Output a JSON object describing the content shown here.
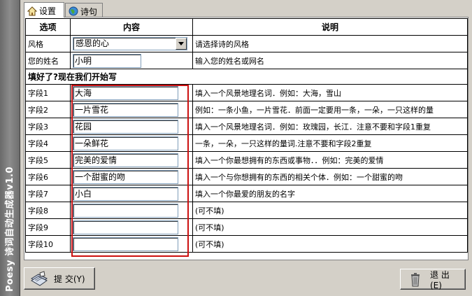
{
  "app": {
    "banner_title": "Poesy 诗词自动生成器v1.0"
  },
  "tabs": [
    {
      "label": "设置",
      "icon": "home-icon",
      "active": true
    },
    {
      "label": "诗句",
      "icon": "globe-icon",
      "active": false
    }
  ],
  "table": {
    "headers": [
      "选项",
      "内容",
      "说明"
    ],
    "style_row": {
      "label": "风格",
      "value": "感恩的心",
      "note": "请选择诗的风格"
    },
    "name_row": {
      "label": "您的姓名",
      "value": "小明",
      "note": "输入您的姓名或网名"
    },
    "section_title": "填好了?现在我们开始写",
    "fields": [
      {
        "label": "字段1",
        "value": "大海",
        "note": "填入一个风景地理名词．例如：大海，雪山"
      },
      {
        "label": "字段2",
        "value": "一片雪花",
        "note": "例如：一条小鱼，一片雪花．前面一定要用一条，一朵，一只这样的量"
      },
      {
        "label": "字段3",
        "value": "花园",
        "note": "填入一个风景地理名词．例如：玫瑰园，长江．注意不要和字段1重复"
      },
      {
        "label": "字段4",
        "value": "一朵鲜花",
        "note": "一条，一朵，一只这样的量词.注意不要和字段2重复"
      },
      {
        "label": "字段5",
        "value": "完美的爱情",
        "note": "填入一个你最想拥有的东西或事物．．例如：完美的爱情"
      },
      {
        "label": "字段6",
        "value": "一个甜蜜的吻",
        "note": "填入一个与你想拥有的东西的相关个体．例如：一个甜蜜的吻"
      },
      {
        "label": "字段7",
        "value": "小白",
        "note": "填入一个你最爱的朋友的名字"
      },
      {
        "label": "字段8",
        "value": "",
        "note": "(可不填)"
      },
      {
        "label": "字段9",
        "value": "",
        "note": "(可不填)"
      },
      {
        "label": "字段10",
        "value": "",
        "note": "(可不填)"
      }
    ]
  },
  "buttons": {
    "submit_label": "提 交(Y)",
    "exit_label": "退 出(E)"
  },
  "colors": {
    "highlight_box": "#cc1010",
    "window_bg": "#d4d0c8"
  }
}
